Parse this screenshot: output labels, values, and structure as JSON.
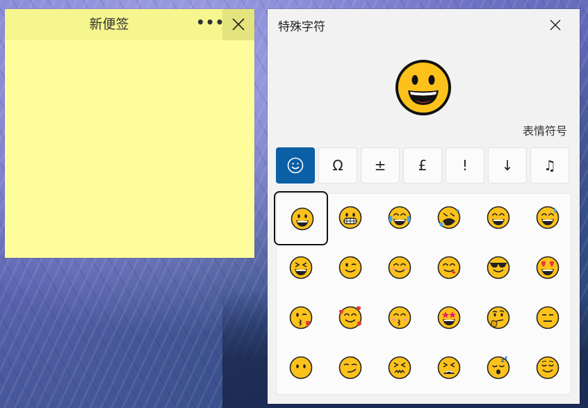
{
  "sticky_note": {
    "title": "新便签",
    "more_label": "•••"
  },
  "emoji_panel": {
    "title": "特殊字符",
    "preview_name": "表情符号",
    "tabs": [
      {
        "label": "",
        "icon": "smiley-icon",
        "active": true
      },
      {
        "label": "Ω",
        "active": false
      },
      {
        "label": "±",
        "active": false
      },
      {
        "label": "£",
        "active": false
      },
      {
        "label": "!",
        "active": false
      },
      {
        "label": "↓",
        "active": false
      },
      {
        "label": "♫",
        "active": false
      }
    ],
    "emojis": [
      "grinning-face",
      "grimacing-face",
      "face-with-tears-of-joy",
      "rolling-on-floor-laughing",
      "smiling-face-with-smiling-eyes-grin",
      "grinning-face-with-sweat",
      "laughing-squinting-face",
      "winking-face",
      "smiling-face",
      "face-savoring-food",
      "smiling-face-with-sunglasses",
      "heart-eyes-face",
      "face-blowing-kiss",
      "smiling-face-with-hearts",
      "kissing-face-with-smiling-eyes",
      "star-struck",
      "thinking-face",
      "neutral-face",
      "face-without-mouth",
      "smirking-face",
      "confounded-face",
      "tired-face",
      "sleeping-face",
      "relieved-face"
    ],
    "selected_index": 0
  },
  "colors": {
    "note_bg": "#fdfd9c",
    "note_header": "#f6f68f",
    "accent": "#0b5fa5",
    "emoji_yellow": "#fcc21b"
  }
}
